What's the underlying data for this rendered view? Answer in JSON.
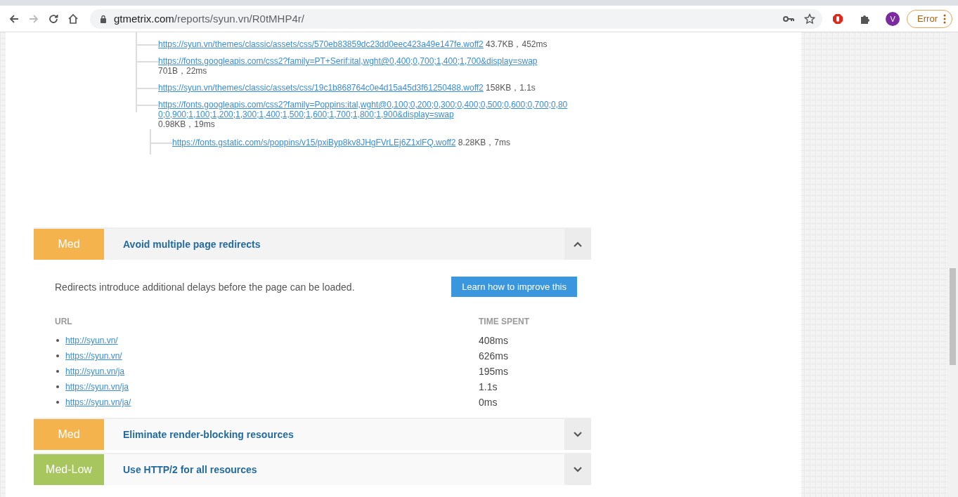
{
  "browser": {
    "url_host": "gtmetrix.com",
    "url_path": "/reports/syun.vn/R0tMHP4r/",
    "forward_disabled": true,
    "profile_initial": "V",
    "status_button": "Error"
  },
  "request_tree": [
    {
      "url": "https://syun.vn/themes/classic/assets/css/570eb83859dc23dd0eec423a49e147fe.woff2",
      "info": "43.7KB，452ms"
    },
    {
      "url": "https://fonts.googleapis.com/css2?family=PT+Serif:ital,wght@0,400;0,700;1,400;1,700&display=swap",
      "info": "701B，22ms"
    },
    {
      "url": "https://syun.vn/themes/classic/assets/css/19c1b868764c0e4d15a45d3f61250488.woff2",
      "info": "158KB，1.1s"
    },
    {
      "url": "https://fonts.googleapis.com/css2?family=Poppins:ital,wght@0,100;0,200;0,300;0,400;0,500;0,600;0,700;0,800;0,900;1,100;1,200;1,300;1,400;1,500;1,600;1,700;1,800;1,900&display=swap",
      "info": "0.98KB，19ms",
      "children": [
        {
          "url": "https://fonts.gstatic.com/s/poppins/v15/pxiByp8kv8JHgFVrLEj6Z1xlFQ.woff2",
          "info": "8.28KB，7ms"
        }
      ]
    }
  ],
  "rules": [
    {
      "severity": "Med",
      "color": "#f5b34d",
      "title": "Avoid multiple page redirects",
      "expanded": true,
      "description": "Redirects introduce additional delays before the page can be loaded.",
      "button": "Learn how to improve this",
      "columns": [
        "URL",
        "TIME SPENT"
      ],
      "rows": [
        {
          "url": "http://syun.vn/",
          "time": "408ms"
        },
        {
          "url": "https://syun.vn/",
          "time": "626ms"
        },
        {
          "url": "http://syun.vn/ja",
          "time": "195ms"
        },
        {
          "url": "https://syun.vn/ja",
          "time": "1.1s"
        },
        {
          "url": "https://syun.vn/ja/",
          "time": "0ms"
        }
      ]
    },
    {
      "severity": "Med",
      "color": "#f5b34d",
      "title": "Eliminate render-blocking resources",
      "expanded": false
    },
    {
      "severity": "Med-Low",
      "color": "#a8c65e",
      "title": "Use HTTP/2 for all resources",
      "expanded": false
    }
  ]
}
